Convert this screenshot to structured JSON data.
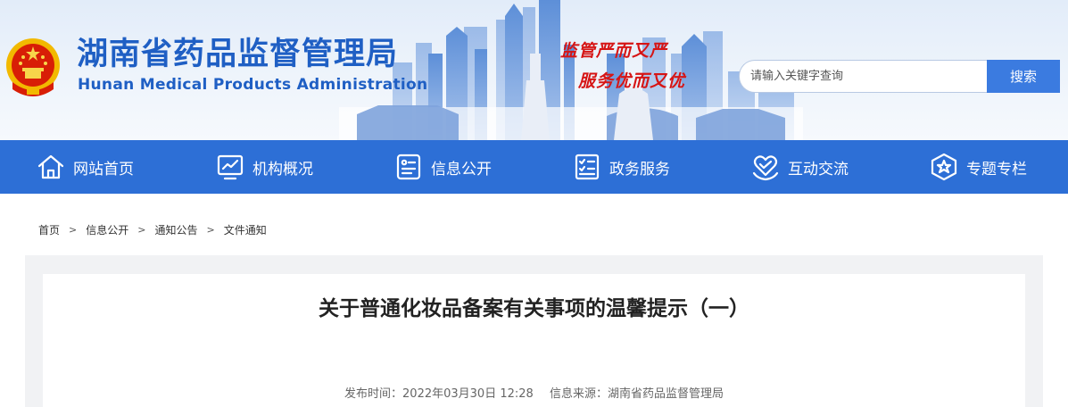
{
  "header": {
    "title_cn": "湖南省药品监督管理局",
    "title_en": "Hunan Medical Products Administration",
    "slogan_line1": "监管严而又严",
    "slogan_line2": "服务优而又优",
    "search": {
      "placeholder": "请输入关键字查询",
      "value": "",
      "button_label": "搜索"
    }
  },
  "nav": {
    "items": [
      {
        "label": "网站首页",
        "icon": "home-icon"
      },
      {
        "label": "机构概况",
        "icon": "monitor-chart-icon"
      },
      {
        "label": "信息公开",
        "icon": "info-card-icon"
      },
      {
        "label": "政务服务",
        "icon": "checklist-icon"
      },
      {
        "label": "互动交流",
        "icon": "heart-hands-icon"
      },
      {
        "label": "专题专栏",
        "icon": "star-badge-icon"
      }
    ]
  },
  "breadcrumb": [
    "首页",
    "信息公开",
    "通知公告",
    "文件通知"
  ],
  "breadcrumb_separator": ">",
  "article": {
    "title": "关于普通化妆品备案有关事项的温馨提示（一）",
    "publish_time": "发布时间：2022年03月30日 12:28",
    "source": "信息来源：湖南省药品监督管理局"
  },
  "colors": {
    "brand_blue": "#1f5fc4",
    "nav_blue": "#2d6fd6",
    "search_button": "#3b7be0",
    "slogan_red": "#d61515",
    "content_bg": "#f1f2f4"
  }
}
